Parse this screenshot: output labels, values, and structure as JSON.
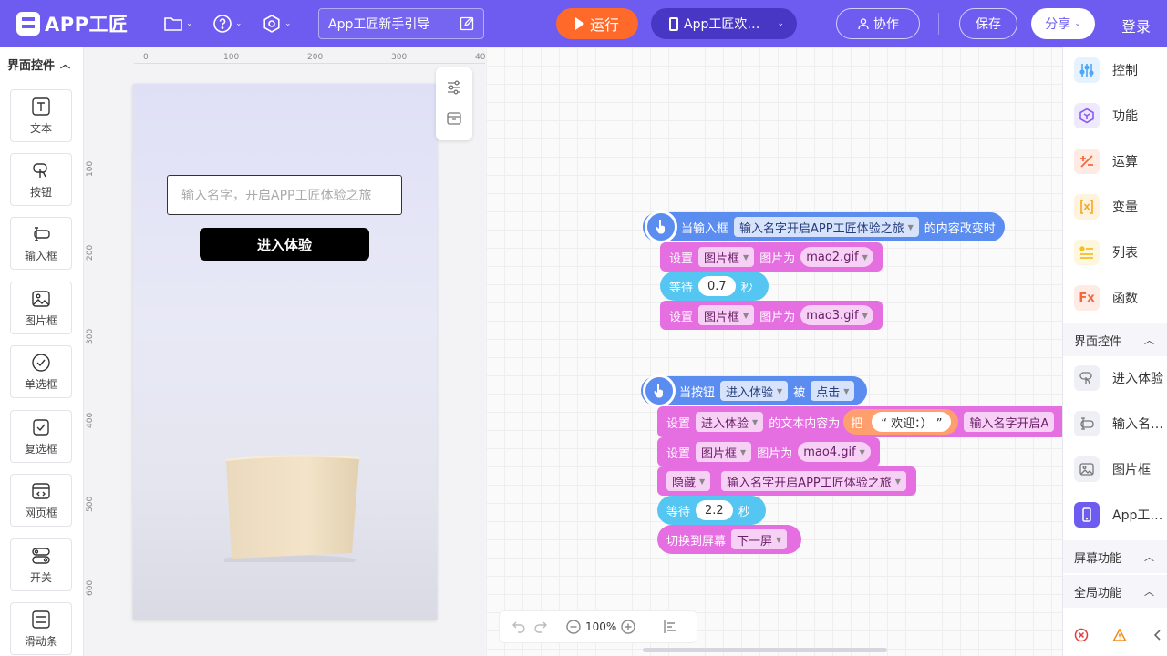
{
  "topbar": {
    "logo_text": "APP工匠",
    "project_name": "App工匠新手引导",
    "run_label": "运行",
    "screen_label": "App工匠欢…",
    "collab_label": "协作",
    "save_label": "保存",
    "share_label": "分享",
    "login_label": "登录"
  },
  "palette": {
    "title": "界面控件",
    "items": [
      {
        "label": "文本",
        "icon": "text-icon"
      },
      {
        "label": "按钮",
        "icon": "button-icon"
      },
      {
        "label": "输入框",
        "icon": "input-icon"
      },
      {
        "label": "图片框",
        "icon": "image-icon"
      },
      {
        "label": "单选框",
        "icon": "radio-icon"
      },
      {
        "label": "复选框",
        "icon": "checkbox-icon"
      },
      {
        "label": "网页框",
        "icon": "webview-icon"
      },
      {
        "label": "开关",
        "icon": "switch-icon"
      },
      {
        "label": "滑动条",
        "icon": "slider-icon"
      }
    ]
  },
  "design": {
    "ruler_h": [
      "0",
      "100",
      "200",
      "300",
      "40"
    ],
    "ruler_v": [
      "100",
      "200",
      "300",
      "400",
      "500",
      "600"
    ],
    "input_placeholder": "输入名字，开启APP工匠体验之旅",
    "enter_button": "进入体验"
  },
  "blocks": {
    "group1": {
      "event": {
        "prefix": "当输入框",
        "target": "输入名字开启APP工匠体验之旅",
        "suffix": "的内容改变时"
      },
      "set1": {
        "verb": "设置",
        "target": "图片框",
        "prop": "图片为",
        "value": "mao2.gif"
      },
      "wait": {
        "verb": "等待",
        "value": "0.7",
        "unit": "秒"
      },
      "set2": {
        "verb": "设置",
        "target": "图片框",
        "prop": "图片为",
        "value": "mao3.gif"
      }
    },
    "group2": {
      "event": {
        "prefix": "当按钮",
        "target": "进入体验",
        "mid": "被",
        "action": "点击"
      },
      "settext": {
        "verb": "设置",
        "target": "进入体验",
        "prop": "的文本内容为",
        "join": "把",
        "str": "“ 欢迎：） ”",
        "ref": "输入名字开启A"
      },
      "set": {
        "verb": "设置",
        "target": "图片框",
        "prop": "图片为",
        "value": "mao4.gif"
      },
      "hide": {
        "verb": "隐藏",
        "target": "输入名字开启APP工匠体验之旅"
      },
      "wait": {
        "verb": "等待",
        "value": "2.2",
        "unit": "秒"
      },
      "switch": {
        "verb": "切换到屏幕",
        "target": "下一屏"
      }
    }
  },
  "workspace": {
    "zoom": "100%"
  },
  "categories": {
    "items": [
      {
        "label": "控制",
        "icon": "control-icon",
        "color": "#4fa8f5",
        "bg": "#e6f3fe"
      },
      {
        "label": "功能",
        "icon": "function-icon",
        "color": "#8a5cf0",
        "bg": "#efe9fd"
      },
      {
        "label": "运算",
        "icon": "operation-icon",
        "color": "#f56a3c",
        "bg": "#fdebe4"
      },
      {
        "label": "变量",
        "icon": "variable-icon",
        "color": "#f5a623",
        "bg": "#fef3df"
      },
      {
        "label": "列表",
        "icon": "list-icon",
        "color": "#f5c023",
        "bg": "#fef6df"
      },
      {
        "label": "函数",
        "icon": "fx-icon",
        "color": "#f5663c",
        "bg": "#fdebe4"
      }
    ],
    "section_ui": "界面控件",
    "ui_items": [
      {
        "label": "进入体验",
        "icon": "button-icon"
      },
      {
        "label": "输入名…",
        "icon": "input-icon"
      },
      {
        "label": "图片框",
        "icon": "image-icon"
      },
      {
        "label": "App工…",
        "icon": "screen-icon"
      }
    ],
    "section_screen": "屏幕功能",
    "section_global": "全局功能"
  }
}
